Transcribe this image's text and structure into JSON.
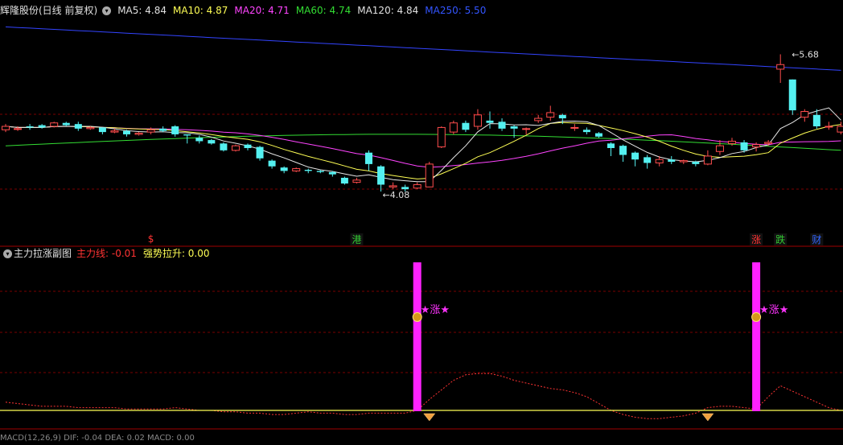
{
  "header": {
    "title": "辉隆股份(日线 前复权)",
    "ma": [
      {
        "label": "MA5: 4.84",
        "color": "#e0e0e0"
      },
      {
        "label": "MA10: 4.87",
        "color": "#ffff55"
      },
      {
        "label": "MA20: 4.71",
        "color": "#ff44ff"
      },
      {
        "label": "MA60: 4.74",
        "color": "#33dd33"
      },
      {
        "label": "MA120: 4.84",
        "color": "#e0e0e0"
      },
      {
        "label": "MA250: 5.50",
        "color": "#3355ff"
      }
    ]
  },
  "sub": {
    "title": "主力拉涨副图",
    "main_line": "主力线: -0.01",
    "strong": "强势拉升: 0.00"
  },
  "bottom_label": "MACD(12,26,9) DIF: -0.04 DEA: 0.02 MACD: 0.00",
  "chart_data": {
    "type": "candlestick",
    "ylim": [
      4.0,
      5.9
    ],
    "annotations": {
      "high": "5.68",
      "low": "4.08"
    },
    "markers": [
      {
        "text": "$",
        "color": "#ff3333",
        "bar": 12
      },
      {
        "text": "港",
        "color": "#33cc33",
        "bar": 29
      },
      {
        "text": "涨",
        "color": "#ff3333",
        "bar": 62
      },
      {
        "text": "跌",
        "color": "#33cc33",
        "bar": 64
      },
      {
        "text": "财",
        "color": "#3366ff",
        "bar": 67
      }
    ],
    "signals": [
      {
        "bar": 34,
        "label": "★涨★"
      },
      {
        "bar": 62,
        "label": "★涨★"
      }
    ],
    "diamonds": [
      35,
      58
    ],
    "candles": [
      [
        4.92,
        4.95,
        4.9,
        4.97
      ],
      [
        4.93,
        4.93,
        4.91,
        4.95
      ],
      [
        4.95,
        4.94,
        4.92,
        4.97
      ],
      [
        4.96,
        4.94,
        4.93,
        4.97
      ],
      [
        4.95,
        4.98,
        4.94,
        4.99
      ],
      [
        4.98,
        4.96,
        4.95,
        4.99
      ],
      [
        4.97,
        4.93,
        4.91,
        4.99
      ],
      [
        4.93,
        4.94,
        4.92,
        4.95
      ],
      [
        4.94,
        4.9,
        4.88,
        4.94
      ],
      [
        4.9,
        4.91,
        4.89,
        4.93
      ],
      [
        4.91,
        4.88,
        4.86,
        4.92
      ],
      [
        4.88,
        4.89,
        4.87,
        4.9
      ],
      [
        4.9,
        4.92,
        4.88,
        4.94
      ],
      [
        4.93,
        4.91,
        4.9,
        4.95
      ],
      [
        4.95,
        4.88,
        4.86,
        4.96
      ],
      [
        4.88,
        4.87,
        4.8,
        4.88
      ],
      [
        4.85,
        4.82,
        4.8,
        4.87
      ],
      [
        4.83,
        4.8,
        4.79,
        4.84
      ],
      [
        4.8,
        4.74,
        4.73,
        4.81
      ],
      [
        4.74,
        4.78,
        4.73,
        4.79
      ],
      [
        4.79,
        4.76,
        4.74,
        4.8
      ],
      [
        4.77,
        4.67,
        4.65,
        4.78
      ],
      [
        4.65,
        4.6,
        4.58,
        4.66
      ],
      [
        4.59,
        4.56,
        4.54,
        4.6
      ],
      [
        4.56,
        4.58,
        4.55,
        4.59
      ],
      [
        4.57,
        4.56,
        4.54,
        4.58
      ],
      [
        4.56,
        4.55,
        4.54,
        4.57
      ],
      [
        4.55,
        4.53,
        4.51,
        4.56
      ],
      [
        4.5,
        4.45,
        4.44,
        4.51
      ],
      [
        4.46,
        4.48,
        4.45,
        4.5
      ],
      [
        4.72,
        4.62,
        4.56,
        4.74
      ],
      [
        4.6,
        4.44,
        4.38,
        4.61
      ],
      [
        4.42,
        4.43,
        4.4,
        4.46
      ],
      [
        4.42,
        4.4,
        4.38,
        4.44
      ],
      [
        4.41,
        4.44,
        4.4,
        4.46
      ],
      [
        4.42,
        4.62,
        4.42,
        4.64
      ],
      [
        4.77,
        4.94,
        4.76,
        4.95
      ],
      [
        4.9,
        4.98,
        4.88,
        5.0
      ],
      [
        4.98,
        4.92,
        4.9,
        5.0
      ],
      [
        4.95,
        5.05,
        4.92,
        5.1
      ],
      [
        5.0,
        4.98,
        4.93,
        5.08
      ],
      [
        4.99,
        4.93,
        4.91,
        5.02
      ],
      [
        4.95,
        4.93,
        4.85,
        4.96
      ],
      [
        4.93,
        4.93,
        4.88,
        4.94
      ],
      [
        5.0,
        5.02,
        4.98,
        5.05
      ],
      [
        5.03,
        5.07,
        5.0,
        5.13
      ],
      [
        5.05,
        5.02,
        4.97,
        5.06
      ],
      [
        4.94,
        4.94,
        4.91,
        4.97
      ],
      [
        4.92,
        4.9,
        4.88,
        4.94
      ],
      [
        4.89,
        4.86,
        4.85,
        4.9
      ],
      [
        4.8,
        4.76,
        4.69,
        4.81
      ],
      [
        4.78,
        4.7,
        4.64,
        4.79
      ],
      [
        4.72,
        4.66,
        4.6,
        4.73
      ],
      [
        4.68,
        4.63,
        4.58,
        4.7
      ],
      [
        4.63,
        4.66,
        4.6,
        4.69
      ],
      [
        4.66,
        4.64,
        4.62,
        4.69
      ],
      [
        4.64,
        4.65,
        4.62,
        4.66
      ],
      [
        4.64,
        4.62,
        4.6,
        4.65
      ],
      [
        4.62,
        4.69,
        4.61,
        4.74
      ],
      [
        4.73,
        4.78,
        4.7,
        4.83
      ],
      [
        4.8,
        4.82,
        4.78,
        4.85
      ],
      [
        4.81,
        4.74,
        4.72,
        4.83
      ],
      [
        4.77,
        4.79,
        4.73,
        4.81
      ],
      [
        4.8,
        4.81,
        4.78,
        4.83
      ],
      [
        5.45,
        5.49,
        5.33,
        5.58
      ],
      [
        5.36,
        5.09,
        5.05,
        5.36
      ],
      [
        5.03,
        5.08,
        4.99,
        5.1
      ],
      [
        5.05,
        4.95,
        4.93,
        5.1
      ],
      [
        4.95,
        4.95,
        4.92,
        4.99
      ],
      [
        4.9,
        4.95,
        4.88,
        4.99
      ]
    ],
    "ma_colors": {
      "MA5": "#e6e6e6",
      "MA10": "#ffff55",
      "MA20": "#ff44ff",
      "MA60": "#33dd33",
      "MA250": "#3344ff"
    },
    "indicator": [
      0.06,
      0.05,
      0.04,
      0.03,
      0.03,
      0.03,
      0.02,
      0.02,
      0.02,
      0.02,
      0.01,
      0.01,
      0.01,
      0.01,
      0.02,
      0.01,
      0.0,
      0.0,
      -0.01,
      -0.01,
      -0.02,
      -0.02,
      -0.03,
      -0.03,
      -0.02,
      -0.01,
      -0.02,
      -0.02,
      -0.03,
      -0.03,
      -0.02,
      -0.02,
      -0.02,
      -0.02,
      0.0,
      0.08,
      0.15,
      0.22,
      0.26,
      0.27,
      0.27,
      0.25,
      0.22,
      0.2,
      0.18,
      0.16,
      0.15,
      0.13,
      0.1,
      0.05,
      0.0,
      -0.03,
      -0.05,
      -0.06,
      -0.06,
      -0.05,
      -0.04,
      -0.02,
      0.02,
      0.03,
      0.03,
      0.02,
      0.01,
      0.1,
      0.18,
      0.14,
      0.1,
      0.06,
      0.02,
      0.0
    ]
  }
}
